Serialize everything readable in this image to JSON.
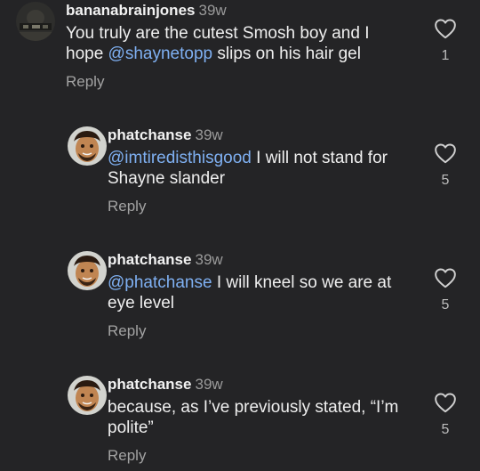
{
  "comments": [
    {
      "username": "bananabrainjones",
      "time": "39w",
      "text_before": "You truly are the cutest Smosh boy and I hope ",
      "mention": "@shaynetopp",
      "text_after": " slips on his hair gel",
      "reply_label": "Reply",
      "likes": "1",
      "avatar_icon": "dark-photo-avatar"
    },
    {
      "username": "phatchanse",
      "time": "39w",
      "mention": "@imtiredisthisgood",
      "text_after": " I will not stand for Shayne slander",
      "reply_label": "Reply",
      "likes": "5",
      "avatar_icon": "face-photo-avatar"
    },
    {
      "username": "phatchanse",
      "time": "39w",
      "mention": "@phatchanse",
      "text_after": " I will kneel so we are at eye level",
      "reply_label": "Reply",
      "likes": "5",
      "avatar_icon": "face-photo-avatar"
    },
    {
      "username": "phatchanse",
      "time": "39w",
      "text_before": "because, as I’ve previously stated, “I’m polite”",
      "reply_label": "Reply",
      "likes": "5",
      "avatar_icon": "face-photo-avatar"
    }
  ],
  "icons": {
    "like": "heart-outline-icon"
  },
  "colors": {
    "background": "#242426",
    "mention": "#7fb0f2",
    "muted": "#9a9a9a"
  }
}
